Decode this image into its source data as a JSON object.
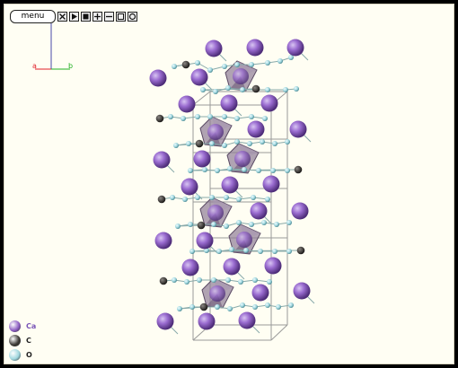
{
  "toolbar": {
    "menu_label": "menu",
    "buttons": [
      {
        "icon": "close-x-icon"
      },
      {
        "icon": "play-icon"
      },
      {
        "icon": "stop-icon"
      },
      {
        "icon": "zoom-in-icon"
      },
      {
        "icon": "zoom-out-icon"
      },
      {
        "icon": "fit-box-icon"
      },
      {
        "icon": "reset-circle-icon"
      }
    ]
  },
  "axes": {
    "a_label": "a",
    "b_label": "b",
    "a_color": "#e0202a",
    "b_color": "#22b022",
    "c_color": "#4a4aa8"
  },
  "legend": {
    "items": [
      {
        "label": "Ca",
        "color": "#8e5fc3",
        "text_color": "#7a55b8"
      },
      {
        "label": "C",
        "color": "#3d3a36",
        "text_color": "#222222"
      },
      {
        "label": "O",
        "color": "#9fd6de",
        "text_color": "#222222"
      }
    ]
  }
}
